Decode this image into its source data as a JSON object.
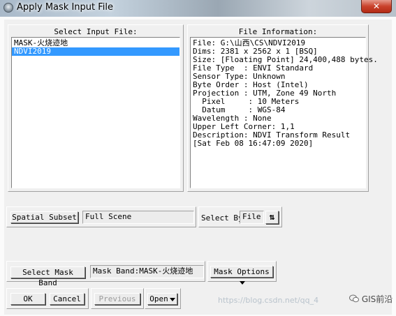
{
  "window": {
    "title": "Apply Mask Input File",
    "close_glyph": "✕",
    "app_icon": "envi-globe-icon"
  },
  "input_file_panel": {
    "title": "Select Input File:",
    "items": [
      {
        "label": "MASK-火烧迹地",
        "selected": false
      },
      {
        "label": "NDVI2019",
        "selected": true
      }
    ]
  },
  "file_info_panel": {
    "title": "File Information:",
    "lines": [
      "File: G:\\山西\\CS\\NDVI2019",
      "Dims: 2381 x 2562 x 1 [BSQ]",
      "Size: [Floating Point] 24,400,488 bytes.",
      "File Type  : ENVI Standard",
      "Sensor Type: Unknown",
      "Byte Order : Host (Intel)",
      "Projection : UTM, Zone 49 North",
      "  Pixel     : 10 Meters",
      "  Datum     : WGS-84",
      "Wavelength : None",
      "Upper Left Corner: 1,1",
      "Description: NDVI Transform Result",
      "[Sat Feb 08 16:47:09 2020]"
    ]
  },
  "spatial_subset": {
    "button_label": "Spatial Subset",
    "value": "Full Scene"
  },
  "select_by": {
    "label": "Select By",
    "value": "File",
    "sort_icon": "⇅"
  },
  "mask": {
    "button_label": "Select Mask Band",
    "value": "Mask Band:MASK-火烧迹地",
    "options_label": "Mask Options"
  },
  "footer": {
    "ok_label": "OK",
    "cancel_label": "Cancel",
    "previous_label": "Previous",
    "open_label": "Open"
  },
  "watermark": {
    "url_text": "https://blog.csdn.net/qq_4",
    "brand_text": "GIS前沿"
  },
  "colors": {
    "selection": "#3399ff",
    "close_button": "#c9422c",
    "dialog_background": "#f0f0f0"
  }
}
